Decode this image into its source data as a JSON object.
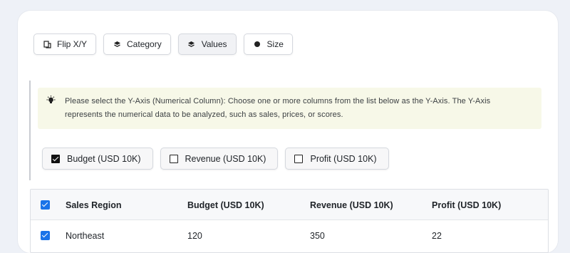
{
  "toolbar": {
    "buttons": [
      {
        "label": "Flip X/Y",
        "icon": "flip-icon"
      },
      {
        "label": "Category",
        "icon": "layers-icon"
      },
      {
        "label": "Values",
        "icon": "layers-icon",
        "active": true
      },
      {
        "label": "Size",
        "icon": "dot-icon"
      }
    ]
  },
  "notice": {
    "icon": "lightbulb-icon",
    "text": "Please select the Y-Axis (Numerical Column): Choose one or more columns from the list below as the Y-Axis. The Y-Axis represents the numerical data to be analyzed, such as sales, prices, or scores.",
    "background": "#f7f8e8"
  },
  "y_options": [
    {
      "label": "Budget (USD 10K)",
      "checked": true
    },
    {
      "label": "Revenue (USD 10K)",
      "checked": false
    },
    {
      "label": "Profit (USD 10K)",
      "checked": false
    }
  ],
  "table": {
    "columns": [
      "Sales Region",
      "Budget (USD 10K)",
      "Revenue (USD 10K)",
      "Profit (USD 10K)"
    ],
    "rows": [
      {
        "checked": true,
        "cells": [
          "Northeast",
          "120",
          "350",
          "22"
        ]
      }
    ],
    "accent": "#1a73e8"
  }
}
